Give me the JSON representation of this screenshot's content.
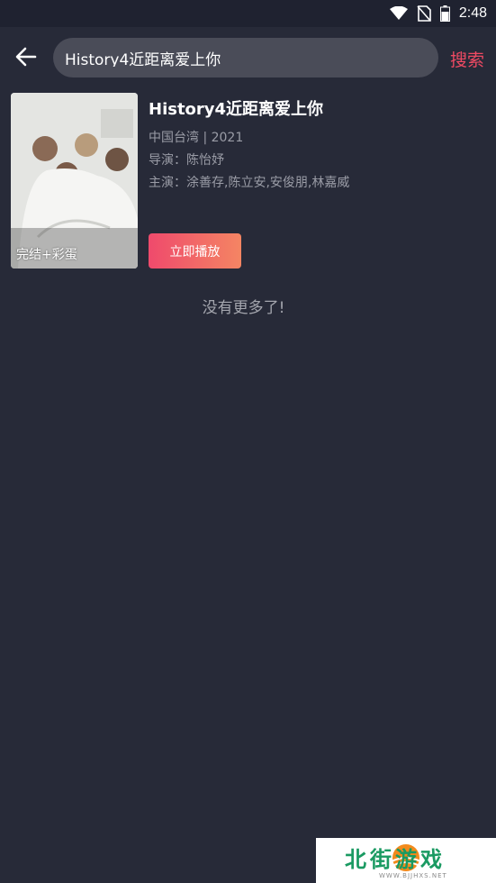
{
  "status_bar": {
    "time": "2:48",
    "icons": [
      "wifi-icon",
      "no-sim-icon",
      "battery-icon"
    ]
  },
  "header": {
    "back_icon": "arrow-left-icon",
    "search_value": "History4近距离爱上你",
    "search_button_label": "搜索"
  },
  "results": [
    {
      "poster_badge": "完结+彩蛋",
      "title": "History4近距离爱上你",
      "region_year": "中国台湾 | 2021",
      "director": "导演：陈怡妤",
      "cast": "主演：涂善存,陈立安,安俊朋,林嘉威",
      "play_button_label": "立即播放"
    }
  ],
  "footer_text": "没有更多了!",
  "watermark": {
    "text": "北街游戏",
    "url": "WWW.BJJHXS.NET"
  },
  "colors": {
    "background": "#272a38",
    "accent": "#ef4a63",
    "play_gradient_start": "#ef4a6c",
    "play_gradient_end": "#f48563"
  }
}
